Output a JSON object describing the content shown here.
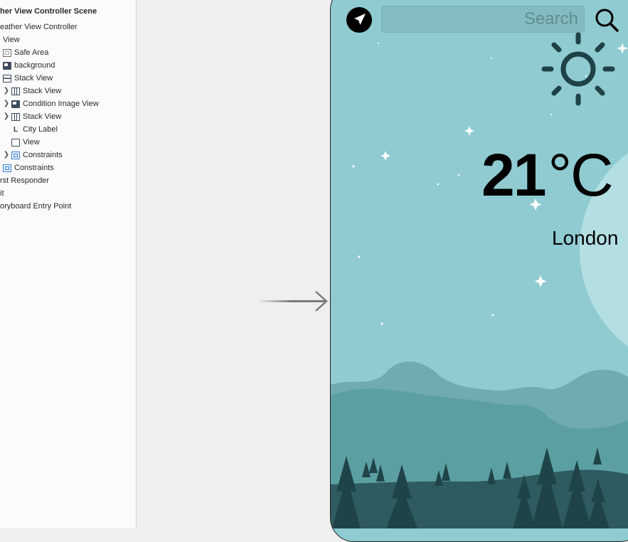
{
  "outline": {
    "rows": [
      {
        "label": "her View Controller Scene"
      },
      {
        "label": "eather View Controller"
      },
      {
        "label": "View"
      },
      {
        "label": "Safe Area"
      },
      {
        "label": "background"
      },
      {
        "label": "Stack View"
      },
      {
        "label": "Stack View"
      },
      {
        "label": "Condition Image View"
      },
      {
        "label": "Stack View"
      },
      {
        "label": "City Label"
      },
      {
        "label": "View"
      },
      {
        "label": "Constraints"
      },
      {
        "label": "Constraints"
      },
      {
        "label": "rst Responder"
      },
      {
        "label": "it"
      },
      {
        "label": "oryboard Entry Point"
      }
    ]
  },
  "phone": {
    "search_placeholder": "Search",
    "temperature": "21",
    "unit": "°C",
    "city": "London"
  },
  "icons": {
    "location": "location-arrow-icon",
    "search": "magnifying-glass-icon",
    "condition": "sun-icon"
  },
  "colors": {
    "sky": "#8fcbd0",
    "moon": "#b4dfe2",
    "hill_back": "#70abb0",
    "hill_mid": "#5c9fa3",
    "ground": "#2e5b5f",
    "trees": "#1f4447",
    "icon_dark": "#1e4246"
  }
}
